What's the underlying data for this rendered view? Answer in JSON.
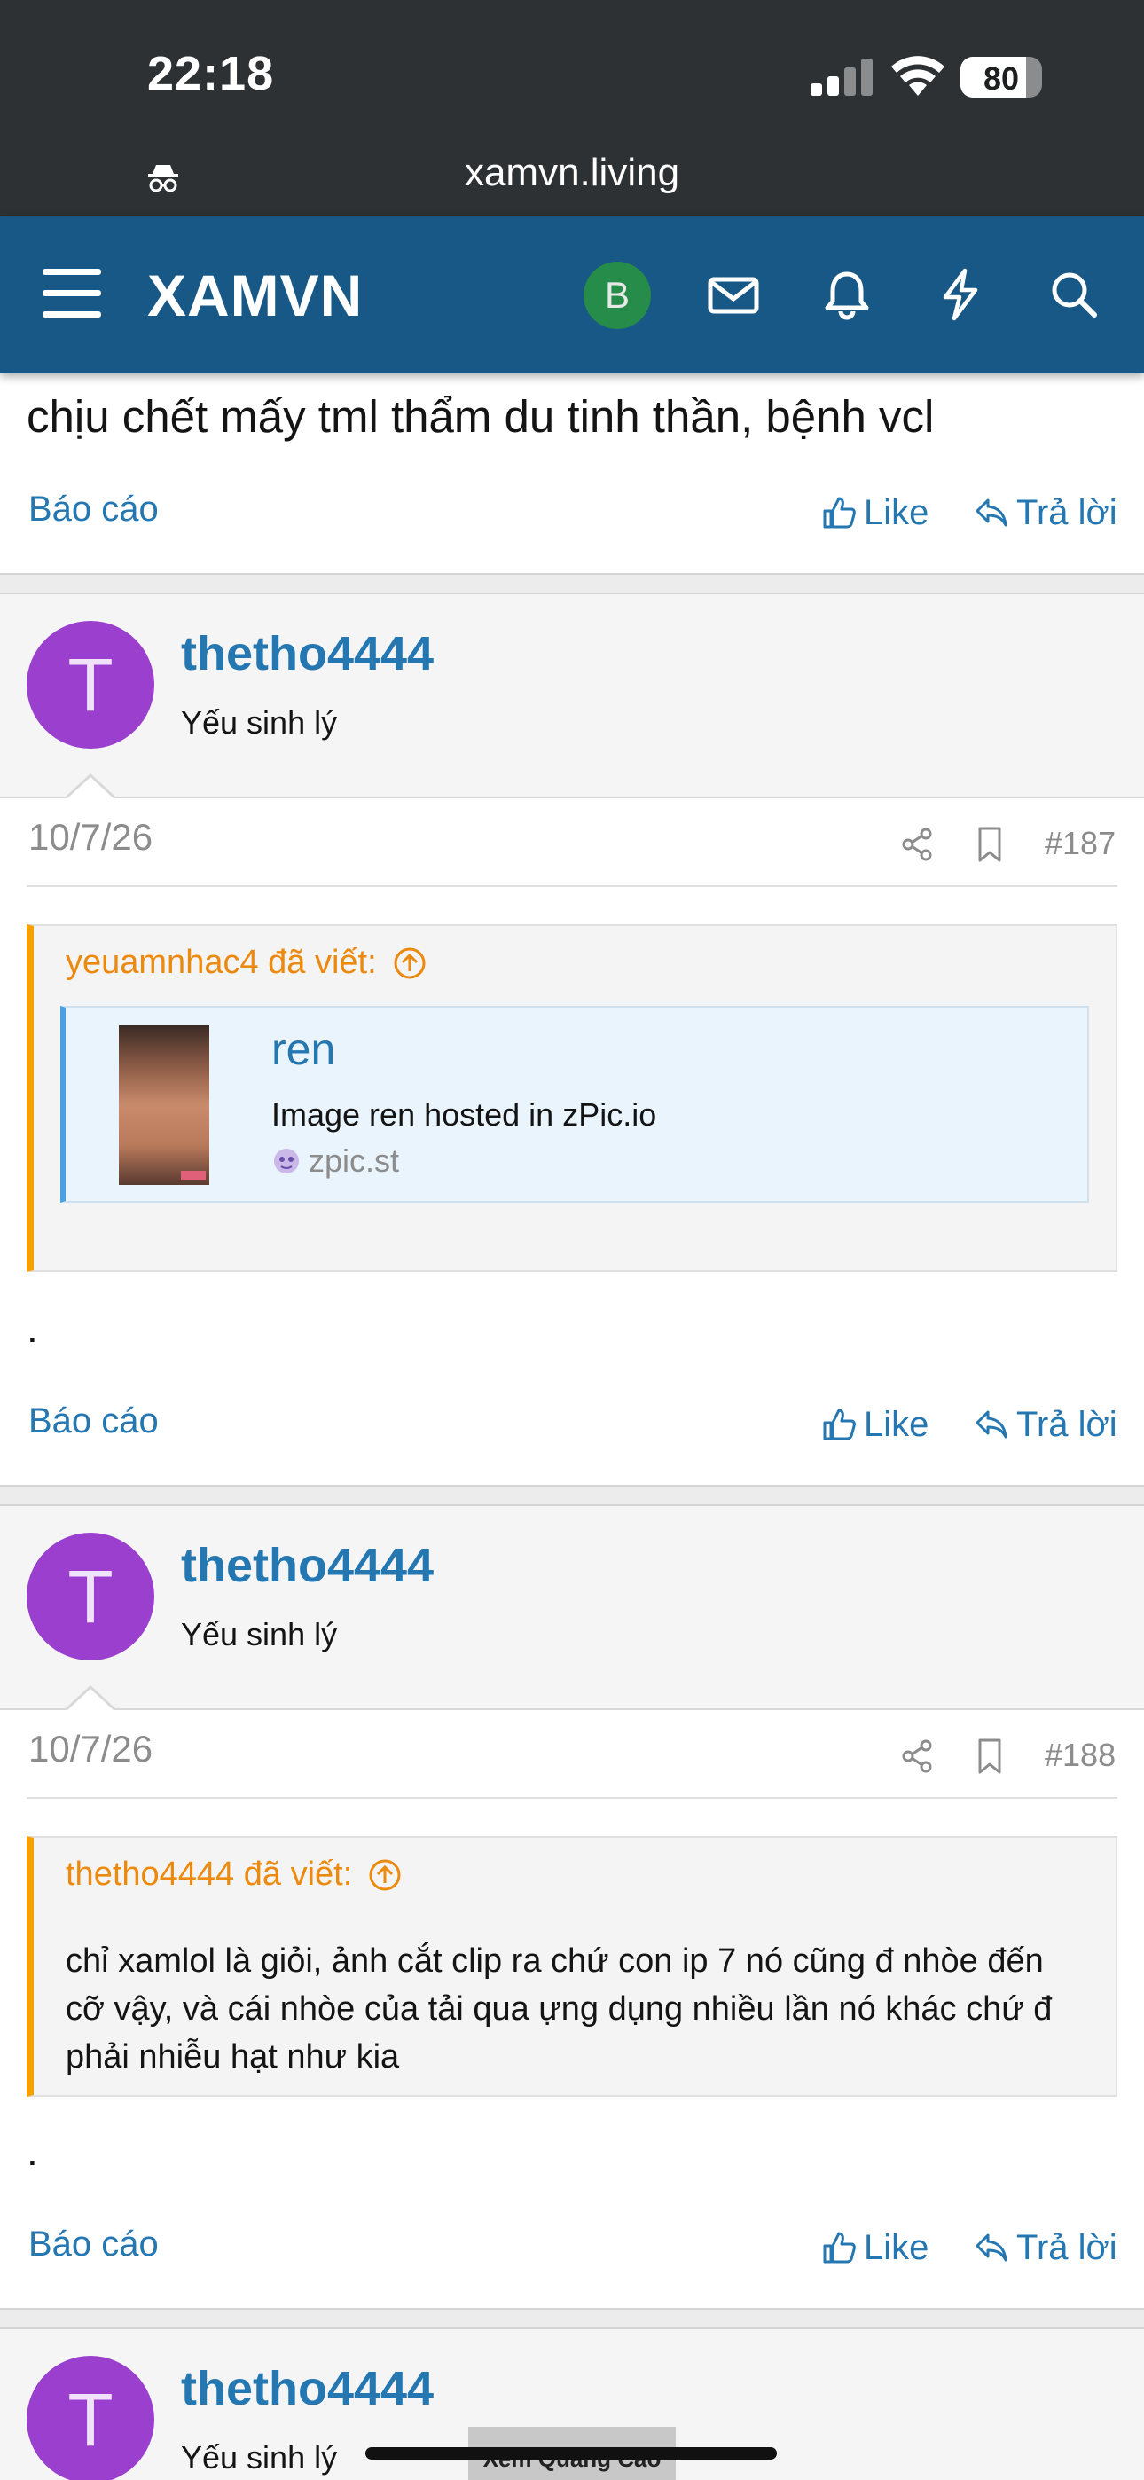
{
  "status_bar": {
    "time": "22:18",
    "battery_percent": "80",
    "battery_level": 0.8
  },
  "url_bar": {
    "url": "xamvn.living",
    "incognito_icon": "incognito-icon"
  },
  "header": {
    "logo": "XAMVN",
    "avatar_letter": "B",
    "avatar_color": "#258c4a",
    "icons": [
      "menu-icon",
      "mail-icon",
      "bell-icon",
      "lightning-icon",
      "search-icon"
    ],
    "bg_color": "#185886"
  },
  "post0": {
    "text": "chịu chết mấy tml thẩm du tinh thần, bệnh vcl",
    "report": "Báo cáo",
    "like": "Like",
    "reply": "Trả lời"
  },
  "post1": {
    "avatar_letter": "T",
    "avatar_color": "#9a3fce",
    "username": "thetho4444",
    "user_title": "Yếu sinh lý",
    "date": "10/7/26",
    "post_number": "#187",
    "quote": {
      "author": "yeuamnhac4 đã viết:",
      "embed": {
        "title": "ren",
        "description": "Image ren hosted in zPic.io",
        "site": "zpic.st"
      }
    },
    "body": ".",
    "report": "Báo cáo",
    "like": "Like",
    "reply": "Trả lời"
  },
  "post2": {
    "avatar_letter": "T",
    "avatar_color": "#9a3fce",
    "username": "thetho4444",
    "user_title": "Yếu sinh lý",
    "date": "10/7/26",
    "post_number": "#188",
    "quote": {
      "author": "thetho4444 đã viết:",
      "text": "chỉ xamlol là giỏi, ảnh cắt clip ra chứ con ip 7 nó cũng đ nhòe đến cỡ vậy, và cái nhòe của tải qua ựng dụng nhiều lần nó khác chứ đ phải nhiễu hạt như kia"
    },
    "body": ".",
    "report": "Báo cáo",
    "like": "Like",
    "reply": "Trả lời"
  },
  "post3": {
    "avatar_letter": "T",
    "username": "thetho4444",
    "user_title": "Yếu sinh lý"
  },
  "overlay": {
    "ad_label": "Xem Quảng Cáo"
  },
  "colors": {
    "link": "#2577b1",
    "quote_accent": "#f7a100",
    "quote_author": "#eb8a0e",
    "muted": "#8c8c8c"
  }
}
